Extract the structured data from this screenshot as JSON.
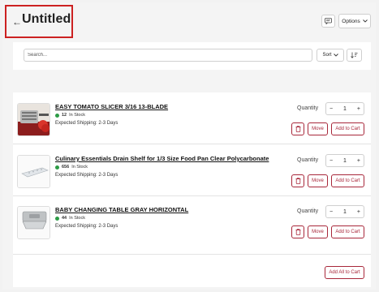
{
  "header": {
    "title": "Untitled",
    "back_icon": "arrow-left-icon",
    "comment_icon": "comment-icon",
    "options_label": "Options"
  },
  "toolbar": {
    "search_placeholder": "Search...",
    "sort_label": "Sort",
    "sort_direction_icon": "sort-descending-icon"
  },
  "items": [
    {
      "name": "EASY TOMATO SLICER 3/16 13-BLADE",
      "stock_count": "12",
      "stock_text": "In Stock",
      "shipping": "Expected Shipping: 2-3 Days",
      "qty_label": "Quantity",
      "quantity": "1",
      "move_label": "Move",
      "cart_label": "Add to Cart"
    },
    {
      "name": "Culinary Essentials Drain Shelf for 1/3 Size Food Pan Clear Polycarbonate",
      "stock_count": "656",
      "stock_text": "In Stock",
      "shipping": "Expected Shipping: 2-3 Days",
      "qty_label": "Quantity",
      "quantity": "1",
      "move_label": "Move",
      "cart_label": "Add to Cart"
    },
    {
      "name": "BABY CHANGING TABLE GRAY HORIZONTAL",
      "stock_count": "44",
      "stock_text": "In Stock",
      "shipping": "Expected Shipping: 2-3 Days",
      "qty_label": "Quantity",
      "quantity": "1",
      "move_label": "Move",
      "cart_label": "Add to Cart"
    }
  ],
  "footer": {
    "add_all_label": "Add All to Cart"
  },
  "colors": {
    "accent": "#a8273a",
    "highlight_border": "#cc2121",
    "in_stock": "#2d9c46"
  }
}
